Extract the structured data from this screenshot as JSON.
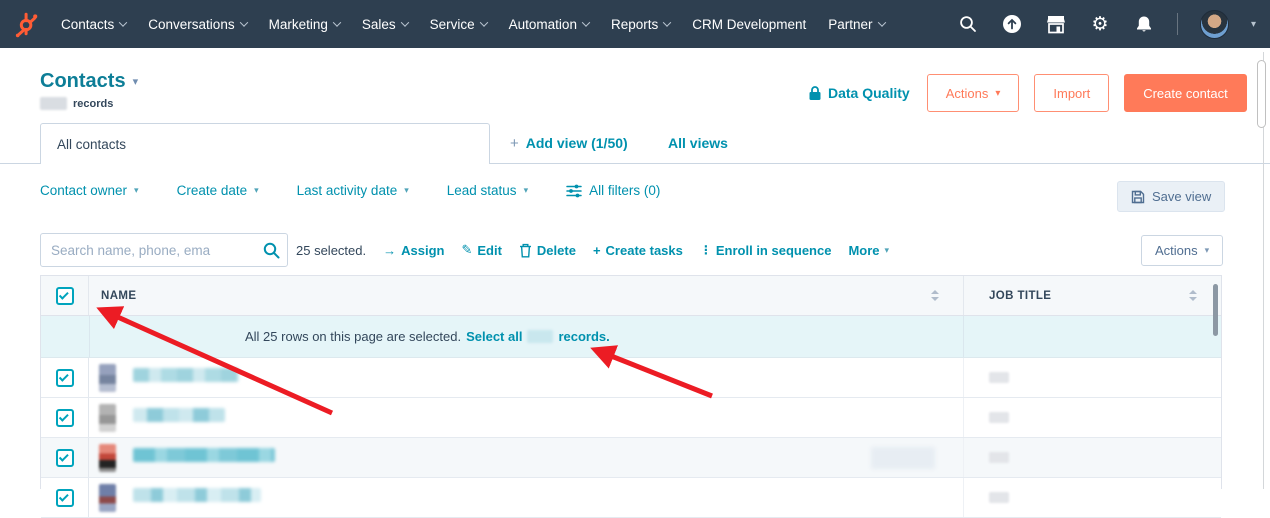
{
  "colors": {
    "nav_bg": "#2e3f50",
    "teal_link": "#0091ae",
    "title_teal": "#0d7e97",
    "orange": "#ff7a59",
    "slate_text": "#33475b",
    "muted_text": "#506e91",
    "border": "#cbd6e2",
    "table_header_bg": "#f5f8fa",
    "selection_banner_bg": "#e5f5f8",
    "checkbox_teal": "#00a4bd",
    "annotation_arrow_red": "#ec1c24"
  },
  "icons": {
    "caret": "▾",
    "plus": "+",
    "arrow_right": "→",
    "pencil": "✎",
    "dots_vertical": "⋮",
    "gear": "⚙"
  },
  "nav": {
    "items": [
      {
        "label": "Contacts",
        "caret": true
      },
      {
        "label": "Conversations",
        "caret": true
      },
      {
        "label": "Marketing",
        "caret": true
      },
      {
        "label": "Sales",
        "caret": true
      },
      {
        "label": "Service",
        "caret": true
      },
      {
        "label": "Automation",
        "caret": true
      },
      {
        "label": "Reports",
        "caret": true
      },
      {
        "label": "CRM Development",
        "caret": false
      },
      {
        "label": "Partner",
        "caret": true
      }
    ]
  },
  "header": {
    "title": "Contacts",
    "records_suffix": "records",
    "records_count_redacted": true,
    "data_quality_label": "Data Quality",
    "actions_label": "Actions",
    "import_label": "Import",
    "create_contact_label": "Create contact"
  },
  "tabs": {
    "active_label": "All contacts",
    "add_view_label": "Add view (1/50)",
    "all_views_label": "All views"
  },
  "filters": {
    "dropdowns": [
      "Contact owner",
      "Create date",
      "Last activity date",
      "Lead status"
    ],
    "all_filters_label": "All filters (0)",
    "save_view_label": "Save view"
  },
  "toolbar": {
    "search_placeholder": "Search name, phone, ema",
    "selected_label": "25 selected.",
    "assign_label": "Assign",
    "edit_label": "Edit",
    "delete_label": "Delete",
    "create_tasks_label": "Create tasks",
    "enroll_label": "Enroll in sequence",
    "more_label": "More",
    "actions_label": "Actions"
  },
  "table": {
    "columns": [
      "NAME",
      "JOB TITLE"
    ],
    "banner": {
      "text": "All 25 rows on this page are selected.",
      "select_all_prefix": "Select all",
      "select_all_count_redacted": true,
      "select_all_suffix": "records."
    },
    "rows": [
      {
        "selected": true,
        "name_redacted": true,
        "job_title_redacted": true
      },
      {
        "selected": true,
        "name_redacted": true,
        "job_title_redacted": true
      },
      {
        "selected": true,
        "name_redacted": true,
        "job_title_redacted": true,
        "extra_redacted_field": true
      },
      {
        "selected": true,
        "name_redacted": true,
        "job_title_redacted": true
      }
    ]
  }
}
